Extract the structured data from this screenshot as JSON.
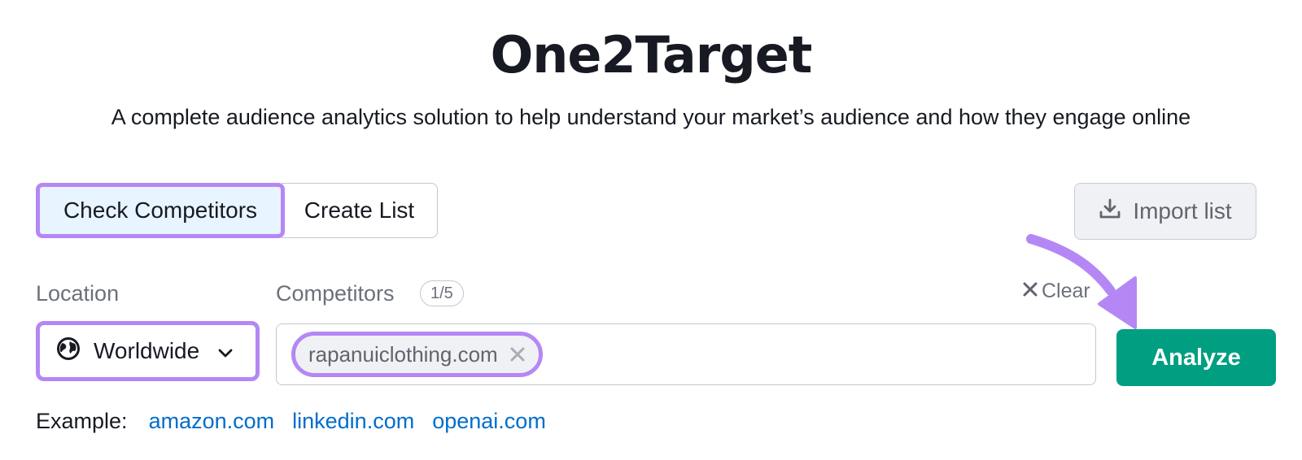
{
  "header": {
    "title": "One2Target",
    "subtitle": "A complete audience analytics solution to help understand your market’s audience and how they engage online"
  },
  "tabs": [
    {
      "label": "Check Competitors",
      "active": true
    },
    {
      "label": "Create List",
      "active": false
    }
  ],
  "import_button": {
    "label": "Import list",
    "icon": "download-icon"
  },
  "location": {
    "label": "Location",
    "value": "Worldwide",
    "icon": "globe-icon"
  },
  "competitors": {
    "label": "Competitors",
    "count_badge": "1/5",
    "clear_label": "Clear",
    "chips": [
      {
        "domain": "rapanuiclothing.com"
      }
    ]
  },
  "analyze_button": {
    "label": "Analyze"
  },
  "example": {
    "label": "Example:",
    "links": [
      "amazon.com",
      "linkedin.com",
      "openai.com"
    ]
  },
  "colors": {
    "highlight": "#b587f5",
    "primary_button": "#009f81",
    "link": "#006dca",
    "active_tab_bg": "#e8f4ff"
  }
}
